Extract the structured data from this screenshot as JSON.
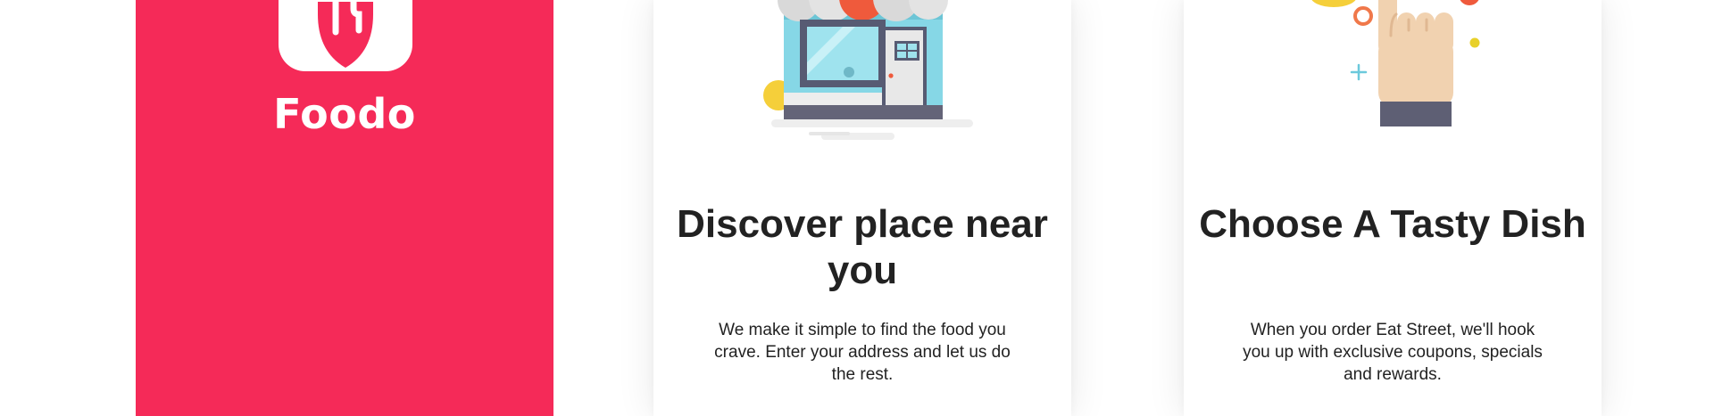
{
  "splash": {
    "brand_name": "Foodo",
    "background_color": "#f52a58",
    "logo_icon": "fork-knife-icon"
  },
  "onboarding": [
    {
      "illustration": "storefront-illustration",
      "title": "Discover place near you",
      "description": "We make it simple to find the food you crave. Enter your address and let us do the rest."
    },
    {
      "illustration": "hand-tap-illustration",
      "title": "Choose A Tasty Dish",
      "description": "When you order Eat Street, we'll hook you up with exclusive coupons, specials and rewards."
    }
  ],
  "colors": {
    "accent": "#f52a58",
    "title_text": "#222222",
    "body_text": "#222222"
  }
}
